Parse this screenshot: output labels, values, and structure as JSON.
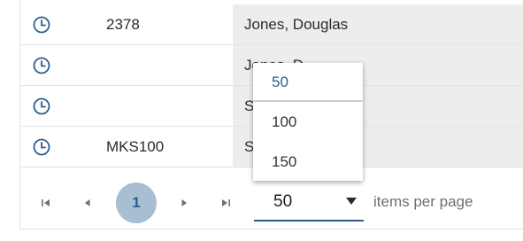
{
  "rows": [
    {
      "icon": "clock-icon",
      "id": "2378",
      "name": "Jones, Douglas"
    },
    {
      "icon": "clock-icon",
      "id": "",
      "name": "Jones, D"
    },
    {
      "icon": "clock-icon",
      "id": "",
      "name": "S"
    },
    {
      "icon": "clock-icon",
      "id": "MKS100",
      "name": "S"
    }
  ],
  "pager": {
    "first_icon": "first-page-icon",
    "prev_icon": "previous-page-icon",
    "current_page": "1",
    "next_icon": "next-page-icon",
    "last_icon": "last-page-icon",
    "page_size_value": "50",
    "items_per_page_label": "items per page"
  },
  "page_size_options": [
    "50",
    "100",
    "150"
  ],
  "colors": {
    "accent": "#2d5d8f",
    "current_page_bg": "#a8bfd3",
    "row_shade": "#ededed",
    "border": "#e3e3e3"
  }
}
